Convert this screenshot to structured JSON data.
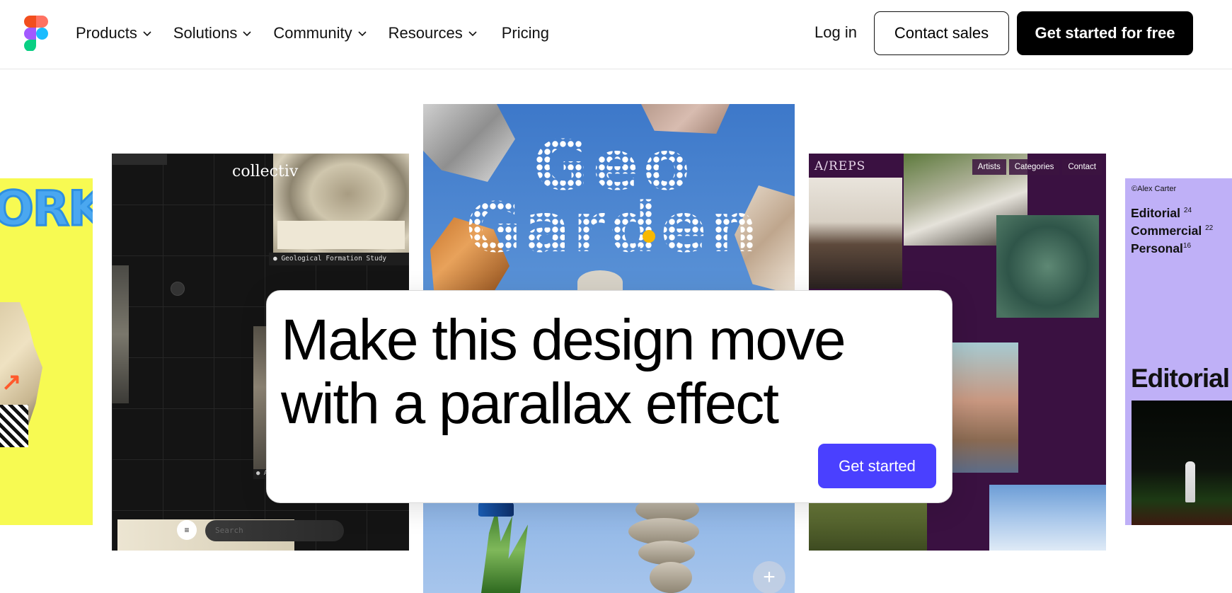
{
  "header": {
    "logo_icon": "figma-logo-icon",
    "nav": [
      {
        "label": "Products",
        "has_dropdown": true
      },
      {
        "label": "Solutions",
        "has_dropdown": true
      },
      {
        "label": "Community",
        "has_dropdown": true
      },
      {
        "label": "Resources",
        "has_dropdown": true
      },
      {
        "label": "Pricing",
        "has_dropdown": false
      }
    ],
    "login_label": "Log in",
    "contact_sales_label": "Contact sales",
    "get_started_free_label": "Get started for free"
  },
  "cards": {
    "yellow": {
      "headline": "ORKS"
    },
    "collectiv": {
      "logo": "collectiv",
      "caption": "● Geological Formation Study",
      "caption2": "● A",
      "search_placeholder": "Search"
    },
    "geo_garden": {
      "title_line1": "Geo",
      "title_line2": "Garden"
    },
    "areps": {
      "brand": "A/REPS",
      "nav": [
        "Artists",
        "Categories",
        "Contact"
      ]
    },
    "alex_carter": {
      "name": "©Alex Carter",
      "items": [
        {
          "label": "Editorial",
          "count": "24"
        },
        {
          "label": "Commercial",
          "count": "22"
        },
        {
          "label": "Personal",
          "count": "16"
        }
      ],
      "big_label": "Editorial"
    }
  },
  "prompt": {
    "text": "Make this design move with a parallax effect",
    "button_label": "Get started"
  },
  "colors": {
    "accent": "#4a40ff",
    "areps_bg": "#3a1141",
    "yellow_bg": "#f7fa52",
    "lavender_bg": "#bfb0f7"
  }
}
